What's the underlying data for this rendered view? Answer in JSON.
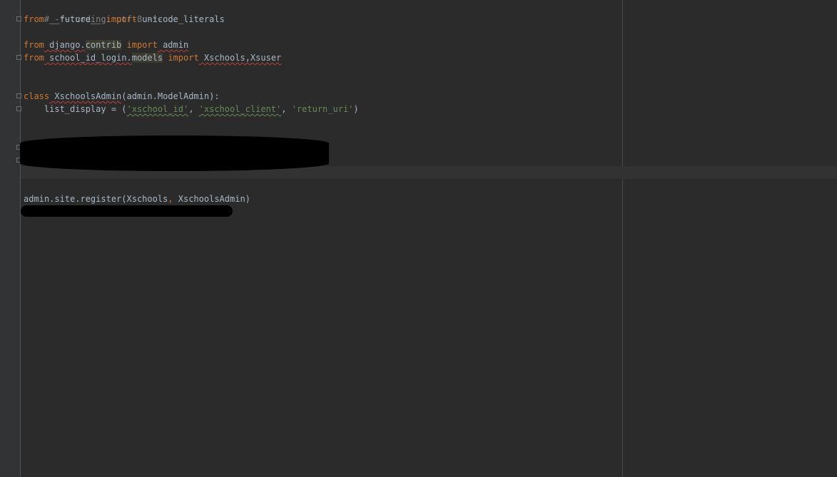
{
  "code": {
    "line1_comment": "# -*- coding: utf-8 -*-",
    "line2_from": "from",
    "line2_mod": " __future__ ",
    "line2_import": "import",
    "line2_name": " unicode_literals",
    "line4_from": "from",
    "line4_mod_a": " django.",
    "line4_mod_b": "contrib",
    "line4_import": " import",
    "line4_name": " admin",
    "line5_from": "from",
    "line5_mod_a": " school_id_login.",
    "line5_mod_b": "models",
    "line5_import": " import",
    "line5_name": " Xschools,Xsuser",
    "line8_class": "class",
    "line8_name": " XschoolsAdmin",
    "line8_rest": "(admin.ModelAdmin):",
    "line9_lhs": "    list_display = (",
    "line9_s1": "'xschool_id'",
    "line9_c1": ", ",
    "line9_s2": "'xschool_client'",
    "line9_c2": ", ",
    "line9_s3": "'return_uri'",
    "line9_end": ")",
    "line16_a": "admin.site.register(Xschools",
    "line16_comma": ",",
    "line16_b": " XschoolsAdmin)"
  },
  "colors": {
    "background": "#2b2b2b",
    "gutter": "#313335",
    "keyword": "#cc7832",
    "string": "#6a8759",
    "comment": "#808080",
    "default_text": "#a9b7c6",
    "redaction": "#000000"
  }
}
